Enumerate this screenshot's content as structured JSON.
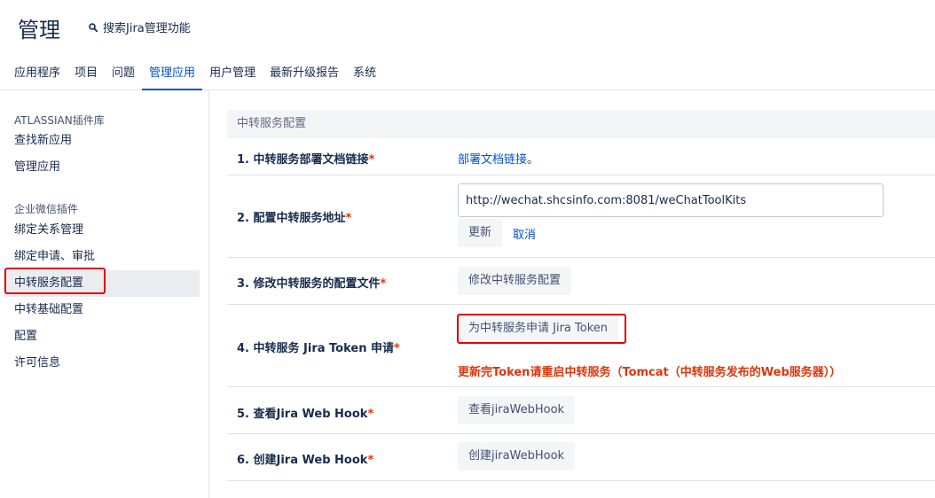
{
  "header": {
    "title": "管理",
    "search_label": "搜索Jira管理功能"
  },
  "tabs": [
    {
      "label": "应用程序",
      "active": false
    },
    {
      "label": "项目",
      "active": false
    },
    {
      "label": "问题",
      "active": false
    },
    {
      "label": "管理应用",
      "active": true
    },
    {
      "label": "用户管理",
      "active": false
    },
    {
      "label": "最新升级报告",
      "active": false
    },
    {
      "label": "系统",
      "active": false
    }
  ],
  "sidebar": {
    "group1": {
      "heading": "ATLASSIAN插件库",
      "items": [
        "查找新应用",
        "管理应用"
      ]
    },
    "group2": {
      "heading": "企业微信插件",
      "items": [
        "绑定关系管理",
        "绑定申请、审批",
        "中转服务配置",
        "中转基础配置",
        "配置",
        "许可信息"
      ]
    },
    "active_item": "中转服务配置"
  },
  "main": {
    "section_title": "中转服务配置",
    "rows": [
      {
        "label": "1. 中转服务部署文档链接",
        "link": "部署文档链接",
        "link_suffix": "。"
      },
      {
        "label": "2. 配置中转服务地址",
        "input_value": "http://wechat.shcsinfo.com:8081/weChatToolKits",
        "update_button": "更新",
        "cancel_link": "取消"
      },
      {
        "label": "3. 修改中转服务的配置文件",
        "button": "修改中转服务配置"
      },
      {
        "label": "4. 中转服务 Jira Token 申请",
        "button": "为中转服务申请 Jira Token",
        "warning": "更新完Token请重启中转服务（Tomcat（中转服务发布的Web服务器））"
      },
      {
        "label": "5. 查看Jira Web Hook",
        "button": "查看jiraWebHook"
      },
      {
        "label": "6. 创建Jira Web Hook",
        "button": "创建jiraWebHook"
      }
    ],
    "required_mark": "*"
  },
  "colors": {
    "accent": "#0052cc",
    "highlight_box": "#e00000",
    "warning_text": "#de350b"
  }
}
